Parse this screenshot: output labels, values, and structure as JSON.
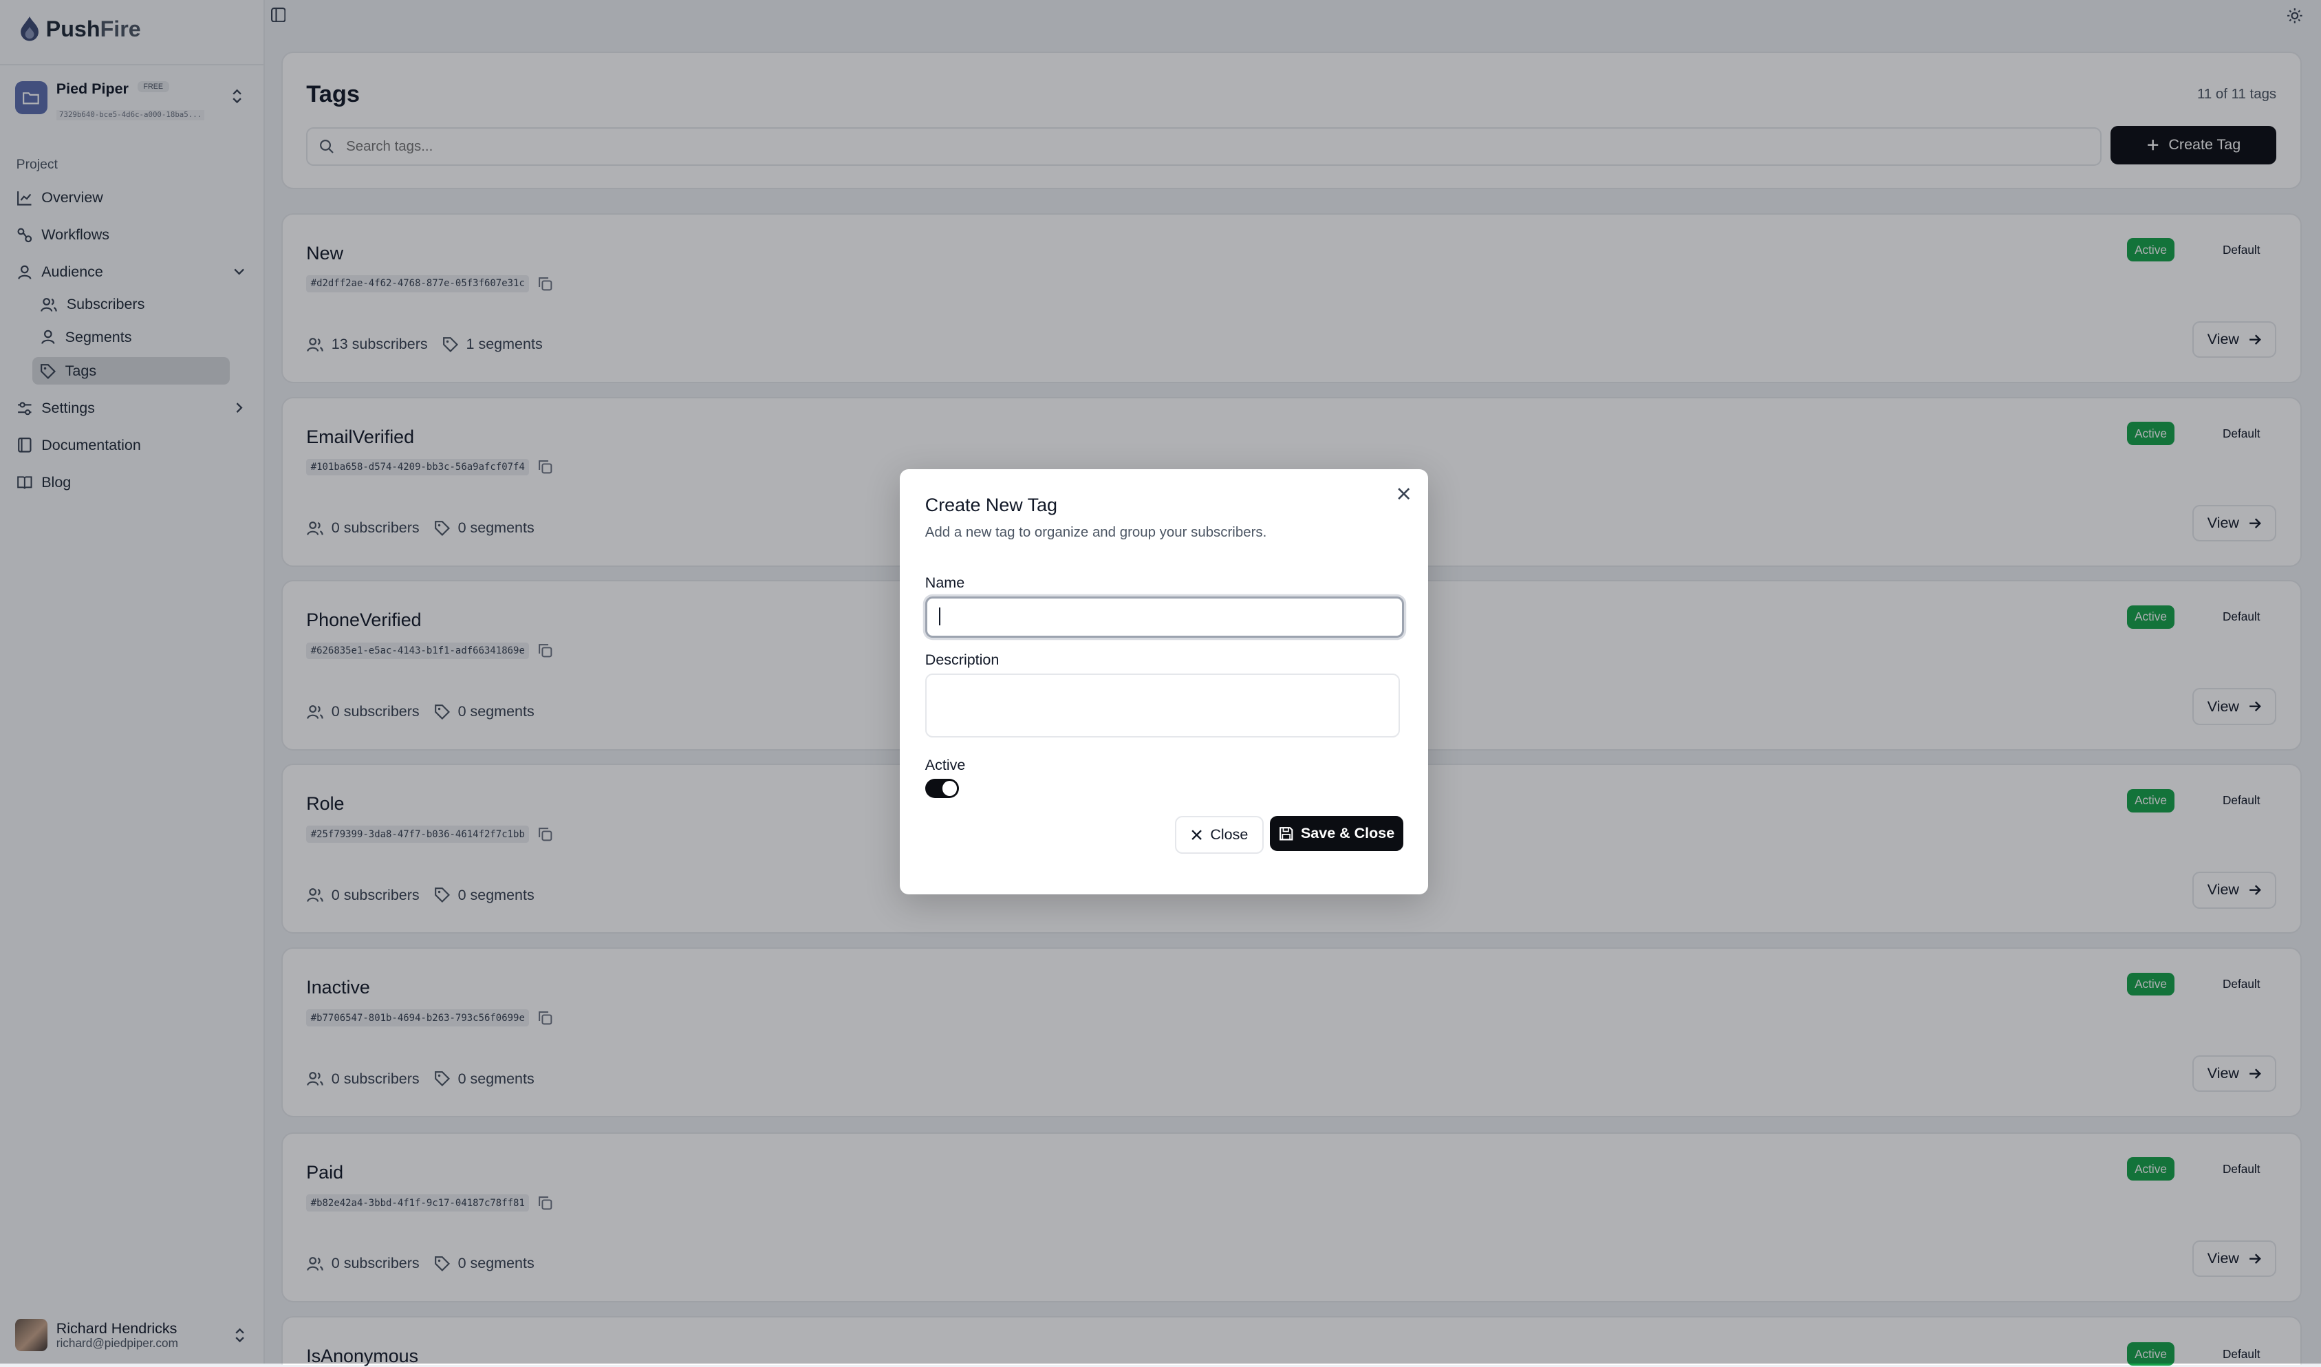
{
  "app": {
    "logo_main": "Push",
    "logo_accent": "Fire"
  },
  "project": {
    "name": "Pied Piper",
    "plan_badge": "FREE",
    "id": "7329b640-bce5-4d6c-a000-18ba5..."
  },
  "sidebar": {
    "section_label": "Project",
    "items": [
      {
        "label": "Overview",
        "icon": "chart-line-icon"
      },
      {
        "label": "Workflows",
        "icon": "workflow-icon"
      },
      {
        "label": "Audience",
        "icon": "user-icon",
        "expanded": true
      },
      {
        "label": "Subscribers",
        "icon": "users-icon"
      },
      {
        "label": "Segments",
        "icon": "user-icon"
      },
      {
        "label": "Tags",
        "icon": "tag-icon",
        "active": true
      },
      {
        "label": "Settings",
        "icon": "sliders-icon"
      },
      {
        "label": "Documentation",
        "icon": "book-icon"
      },
      {
        "label": "Blog",
        "icon": "book-open-icon"
      }
    ]
  },
  "user": {
    "name": "Richard Hendricks",
    "email": "richard@piedpiper.com"
  },
  "header": {
    "title": "Tags",
    "count": "11 of 11 tags",
    "search_placeholder": "Search tags...",
    "create_button": "Create Tag"
  },
  "tags": [
    {
      "name": "New",
      "id": "#d2dff2ae-4f62-4768-877e-05f3f607e31c",
      "subscribers": "13 subscribers",
      "segments": "1 segments",
      "status": "Active",
      "default_label": "Default",
      "view": "View"
    },
    {
      "name": "EmailVerified",
      "id": "#101ba658-d574-4209-bb3c-56a9afcf07f4",
      "subscribers": "0 subscribers",
      "segments": "0 segments",
      "status": "Active",
      "default_label": "Default",
      "view": "View"
    },
    {
      "name": "PhoneVerified",
      "id": "#626835e1-e5ac-4143-b1f1-adf66341869e",
      "subscribers": "0 subscribers",
      "segments": "0 segments",
      "status": "Active",
      "default_label": "Default",
      "view": "View"
    },
    {
      "name": "Role",
      "id": "#25f79399-3da8-47f7-b036-4614f2f7c1bb",
      "subscribers": "0 subscribers",
      "segments": "0 segments",
      "status": "Active",
      "default_label": "Default",
      "view": "View"
    },
    {
      "name": "Inactive",
      "id": "#b7706547-801b-4694-b263-793c56f0699e",
      "subscribers": "0 subscribers",
      "segments": "0 segments",
      "status": "Active",
      "default_label": "Default",
      "view": "View"
    },
    {
      "name": "Paid",
      "id": "#b82e42a4-3bbd-4f1f-9c17-04187c78ff81",
      "subscribers": "0 subscribers",
      "segments": "0 segments",
      "status": "Active",
      "default_label": "Default",
      "view": "View"
    },
    {
      "name": "IsAnonymous",
      "status": "Active",
      "default_label": "Default"
    }
  ],
  "modal": {
    "title": "Create New Tag",
    "subtitle": "Add a new tag to organize and group your subscribers.",
    "name_label": "Name",
    "name_value": "",
    "description_label": "Description",
    "description_value": "",
    "active_label": "Active",
    "active_on": true,
    "close_button": "Close",
    "save_button": "Save & Close"
  },
  "colors": {
    "primary": "#0b0d12",
    "active_badge": "#16a34a",
    "project_icon": "#5b6eae"
  }
}
